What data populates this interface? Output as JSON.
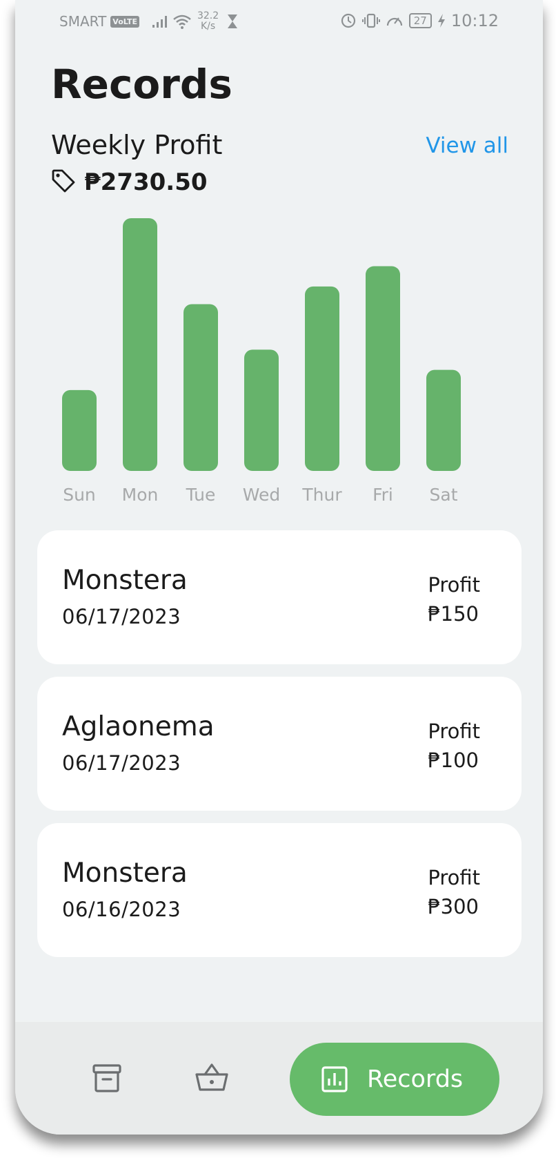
{
  "status_bar": {
    "carrier": "SMART",
    "volte": "VoLTE",
    "speed_value": "32.2",
    "speed_unit": "K/s",
    "battery": "27",
    "time": "10:12"
  },
  "page": {
    "title": "Records",
    "weekly_label": "Weekly Profit",
    "view_all": "View all",
    "weekly_total": "₱2730.50"
  },
  "chart_data": {
    "type": "bar",
    "categories": [
      "Sun",
      "Mon",
      "Tue",
      "Wed",
      "Thur",
      "Fri",
      "Sat"
    ],
    "values": [
      0.32,
      1.0,
      0.66,
      0.48,
      0.73,
      0.81,
      0.4
    ],
    "color": "#66b36b",
    "tick_color": "#a7a9aa"
  },
  "records": [
    {
      "name": "Monstera",
      "date": "06/17/2023",
      "profit_label": "Profit",
      "profit": "₱150"
    },
    {
      "name": "Aglaonema",
      "date": "06/17/2023",
      "profit_label": "Profit",
      "profit": "₱100"
    },
    {
      "name": "Monstera",
      "date": "06/16/2023",
      "profit_label": "Profit",
      "profit": "₱300"
    }
  ],
  "nav": {
    "items": [
      {
        "icon": "archive-icon"
      },
      {
        "icon": "basket-icon"
      },
      {
        "icon": "bar-chart-icon",
        "label": "Records",
        "active": true
      }
    ],
    "accent": "#66bb6a"
  }
}
